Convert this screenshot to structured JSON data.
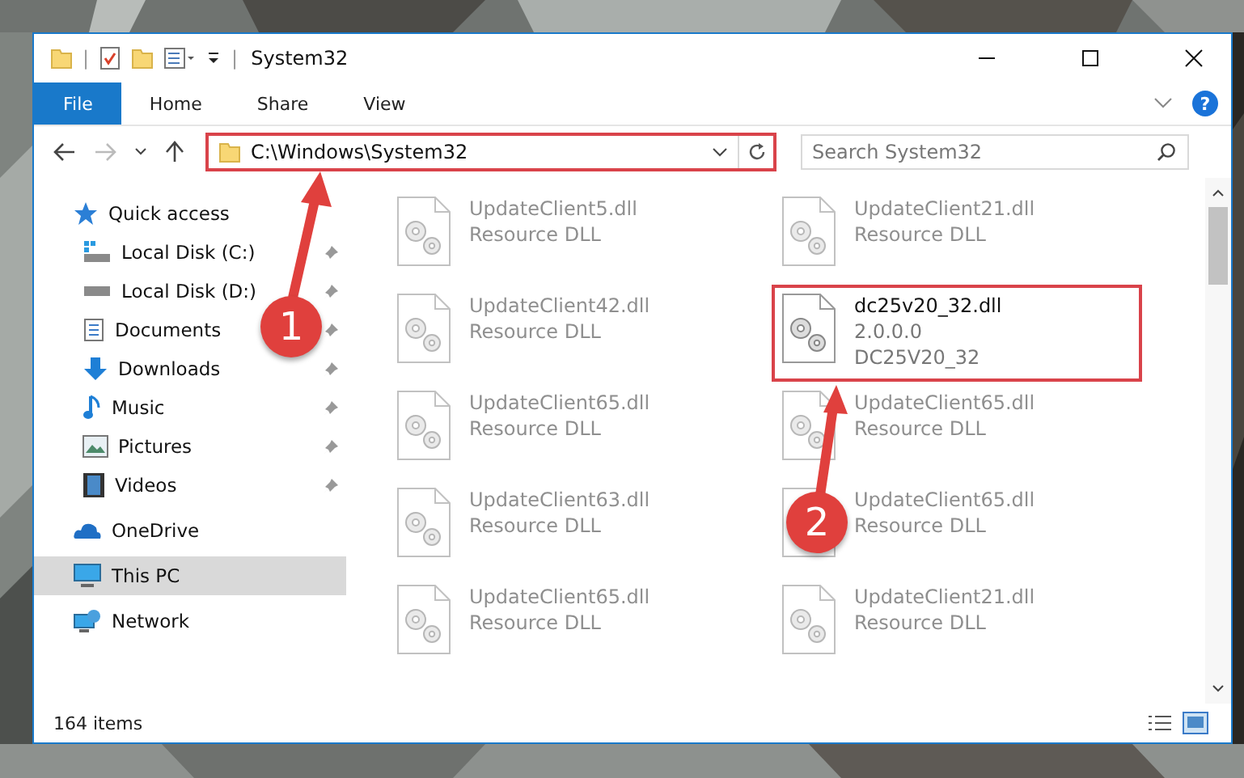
{
  "window": {
    "title": "System32",
    "separator": "|"
  },
  "ribbon": {
    "tabs": [
      {
        "label": "File",
        "selected": true
      },
      {
        "label": "Home",
        "selected": false
      },
      {
        "label": "Share",
        "selected": false
      },
      {
        "label": "View",
        "selected": false
      }
    ],
    "help": "?"
  },
  "address": {
    "path": "C:\\Windows\\System32",
    "highlighted": true
  },
  "search": {
    "placeholder": "Search System32"
  },
  "sidebar": {
    "items": [
      {
        "label": "Quick access",
        "kind": "star",
        "selected": false,
        "children": [
          {
            "label": "Local Disk (C:)",
            "kind": "system-disk",
            "pinned": true,
            "selected": false
          },
          {
            "label": "Local Disk (D:)",
            "kind": "disk",
            "pinned": true,
            "selected": false
          },
          {
            "label": "Documents",
            "kind": "document",
            "pinned": true,
            "selected": false
          },
          {
            "label": "Downloads",
            "kind": "download",
            "pinned": true,
            "selected": false
          },
          {
            "label": "Music",
            "kind": "music",
            "pinned": true,
            "selected": false
          },
          {
            "label": "Pictures",
            "kind": "pictures",
            "pinned": true,
            "selected": false
          },
          {
            "label": "Videos",
            "kind": "videos",
            "pinned": true,
            "selected": false
          }
        ]
      },
      {
        "label": "OneDrive",
        "kind": "cloud",
        "selected": false
      },
      {
        "label": "This PC",
        "kind": "computer",
        "selected": true
      },
      {
        "label": "Network",
        "kind": "network",
        "selected": false
      }
    ]
  },
  "files": [
    {
      "name": "UpdateClient5.dll",
      "details": [
        "Resource DLL"
      ],
      "dimmed": true,
      "highlighted": false
    },
    {
      "name": "UpdateClient21.dll",
      "details": [
        "Resource DLL"
      ],
      "dimmed": true,
      "highlighted": false
    },
    {
      "name": "UpdateClient42.dll",
      "details": [
        "Resource DLL"
      ],
      "dimmed": true,
      "highlighted": false
    },
    {
      "name": "dc25v20_32.dll",
      "details": [
        "2.0.0.0",
        "DC25V20_32"
      ],
      "dimmed": false,
      "highlighted": true
    },
    {
      "name": "UpdateClient65.dll",
      "details": [
        "Resource DLL"
      ],
      "dimmed": true,
      "highlighted": false
    },
    {
      "name": "UpdateClient65.dll",
      "details": [
        "Resource DLL"
      ],
      "dimmed": true,
      "highlighted": false
    },
    {
      "name": "UpdateClient63.dll",
      "details": [
        "Resource DLL"
      ],
      "dimmed": true,
      "highlighted": false
    },
    {
      "name": "UpdateClient65.dll",
      "details": [
        "Resource DLL"
      ],
      "dimmed": true,
      "highlighted": false
    },
    {
      "name": "UpdateClient65.dll",
      "details": [
        "Resource DLL"
      ],
      "dimmed": true,
      "highlighted": false
    },
    {
      "name": "UpdateClient21.dll",
      "details": [
        "Resource DLL"
      ],
      "dimmed": true,
      "highlighted": false
    }
  ],
  "status_bar": {
    "item_count": "164 items"
  },
  "annotations": [
    {
      "label": "1"
    },
    {
      "label": "2"
    }
  ]
}
